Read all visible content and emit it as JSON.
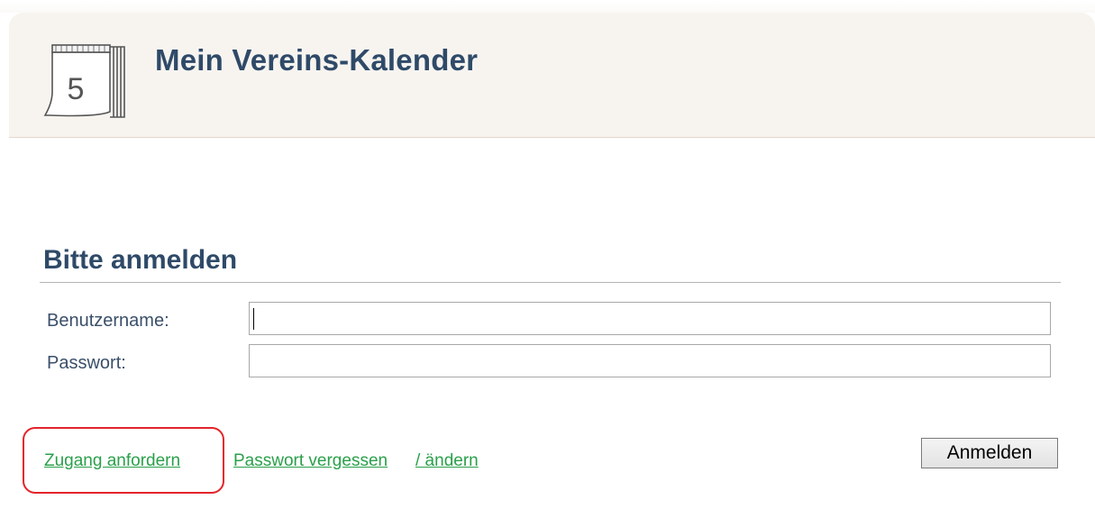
{
  "header": {
    "title": "Mein Vereins-Kalender",
    "icon": "calendar-day-icon",
    "icon_day": "5"
  },
  "login": {
    "heading": "Bitte anmelden",
    "username_label": "Benutzername:",
    "username_value": "",
    "password_label": "Passwort:",
    "password_value": "",
    "submit_label": "Anmelden"
  },
  "links": {
    "request_access": "Zugang anfordern",
    "forgot_password": "Passwort vergessen",
    "change_password": "/ ändern"
  },
  "colors": {
    "title": "#2f4a68",
    "link": "#2aa04a",
    "highlight": "#e3242b",
    "header_bg": "#f7f4f0"
  }
}
